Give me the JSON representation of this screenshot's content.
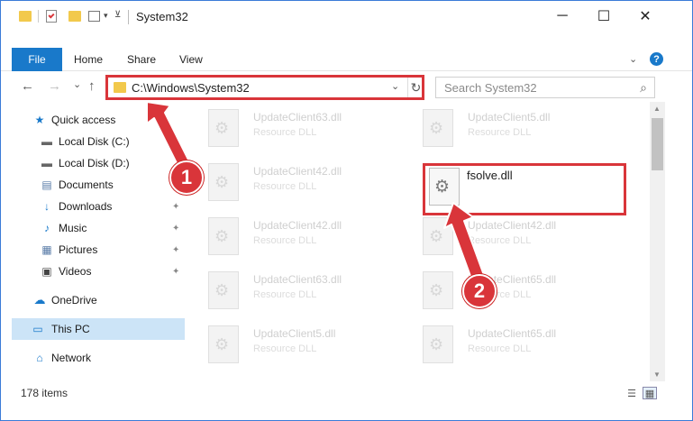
{
  "window": {
    "title": "System32",
    "controls": {
      "minimize": "─",
      "maximize": "☐",
      "close": "✕"
    }
  },
  "ribbon": {
    "tabs": [
      {
        "label": "File"
      },
      {
        "label": "Home"
      },
      {
        "label": "Share"
      },
      {
        "label": "View"
      }
    ],
    "expand_icon": "⌄",
    "help_icon": "?"
  },
  "address_bar": {
    "back": "←",
    "forward": "→",
    "recent": "⌄",
    "up": "↑",
    "path": "C:\\Windows\\System32",
    "dropdown": "⌄",
    "refresh": "↻"
  },
  "search": {
    "placeholder": "Search System32",
    "icon": "⌕"
  },
  "sidebar": {
    "items": [
      {
        "label": "Quick access",
        "icon": "★",
        "pinned": false
      },
      {
        "label": "Local Disk (C:)",
        "icon": "▬",
        "pinned": true
      },
      {
        "label": "Local Disk (D:)",
        "icon": "▬",
        "pinned": false
      },
      {
        "label": "Documents",
        "icon": "▤",
        "pinned": true
      },
      {
        "label": "Downloads",
        "icon": "↓",
        "pinned": true
      },
      {
        "label": "Music",
        "icon": "♪",
        "pinned": true
      },
      {
        "label": "Pictures",
        "icon": "▦",
        "pinned": true
      },
      {
        "label": "Videos",
        "icon": "▣",
        "pinned": true
      },
      {
        "label": "OneDrive",
        "icon": "☁",
        "pinned": false
      },
      {
        "label": "This PC",
        "icon": "▭",
        "pinned": false,
        "selected": true
      },
      {
        "label": "Network",
        "icon": "⌂",
        "pinned": false
      }
    ],
    "pin_icon": "📌"
  },
  "files": [
    {
      "name": "UpdateClient63.dll",
      "type": "Resource DLL"
    },
    {
      "name": "UpdateClient5.dll",
      "type": "Resource DLL"
    },
    {
      "name": "UpdateClient42.dll",
      "type": "Resource DLL"
    },
    {
      "name": "UpdateClient42.dll",
      "type": "Resource DLL"
    },
    {
      "name": "UpdateClient42.dll",
      "type": "Resource DLL"
    },
    {
      "name": "UpdateClient63.dll",
      "type": "Resource DLL"
    },
    {
      "name": "UpdateClient65.dll",
      "type": "Resource DLL"
    },
    {
      "name": "UpdateClient5.dll",
      "type": "Resource DLL"
    },
    {
      "name": "UpdateClient65.dll",
      "type": "Resource DLL"
    }
  ],
  "highlighted_file": {
    "name": "fsolve.dll"
  },
  "status_bar": {
    "item_count": "178 items",
    "details_view_icon": "☰",
    "tiles_view_icon": "▦"
  },
  "annotations": {
    "badge_1": "1",
    "badge_2": "2",
    "color": "#d9353a"
  },
  "colors": {
    "accent": "#1979ca",
    "selection": "#cce4f7",
    "highlight": "#d9353a"
  }
}
